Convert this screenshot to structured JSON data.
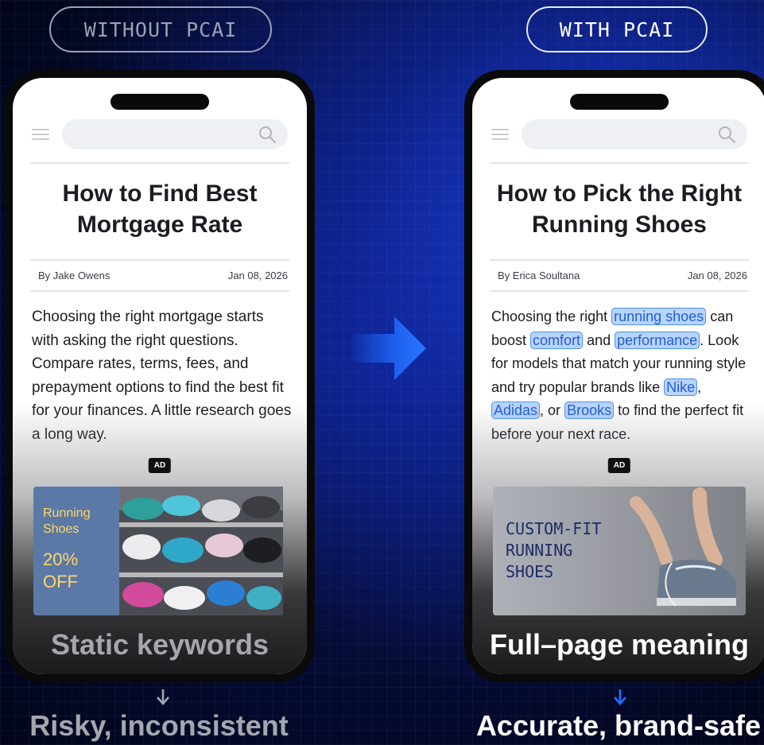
{
  "labels": {
    "left_pill": "WITHOUT PCAI",
    "right_pill": "WITH PCAI"
  },
  "left_phone": {
    "title": "How to Find Best Mortgage Rate",
    "author": "By Jake Owens",
    "date": "Jan 08, 2026",
    "body": "Choosing the right mortgage starts with asking the right questions. Compare rates, terms, fees, and prepayment options to find the best fit for your finances. A little research goes a long way.",
    "ad_badge": "AD",
    "ad_line1": "Running",
    "ad_line2": "Shoes",
    "ad_line3": "20%",
    "ad_line4": "OFF",
    "caption": "Static keywords"
  },
  "right_phone": {
    "title": "How to Pick the Right Running Shoes",
    "author": "By Erica Soultana",
    "date": "Jan 08, 2026",
    "body_parts": {
      "p1": "Choosing the right ",
      "k1": "running shoes",
      "p2": " can boost ",
      "k2": "comfort",
      "p3": " and ",
      "k3": "performance",
      "p4": ". Look for models that match your running style and try popular brands like ",
      "k4": "Nike",
      "p5": ", ",
      "k5": "Adidas",
      "p6": ", or ",
      "k6": "Brooks",
      "p7": " to find the perfect fit before your next race."
    },
    "ad_badge": "AD",
    "ad_line1": "CUSTOM-FIT",
    "ad_line2": "RUNNING",
    "ad_line3": "SHOES",
    "caption": "Full–page meaning"
  },
  "results": {
    "left": "Risky, inconsistent",
    "right": "Accurate, brand-safe"
  },
  "colors": {
    "accent_blue": "#1f6bff",
    "keyword_bg": "#b9d4ff",
    "muted_gray": "#9aa1b2"
  }
}
